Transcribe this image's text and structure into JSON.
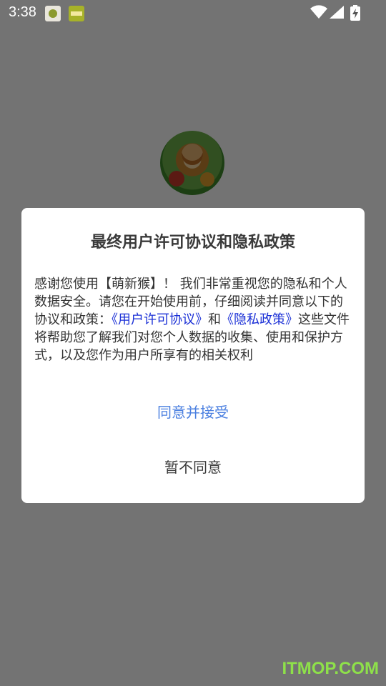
{
  "status_bar": {
    "time": "3:38",
    "notification_icons": [
      "app-notification-icon",
      "app-notification-icon"
    ],
    "system_icons": [
      "wifi-icon",
      "signal-icon",
      "battery-charging-icon"
    ]
  },
  "background": {
    "avatar": "app-logo-monkey"
  },
  "dialog": {
    "title": "最终用户许可协议和隐私政策",
    "body_part1": "感谢您使用【萌新猴】！ 我们非常重视您的隐私和个人数据安全。请您在开始使用前，仔细阅读并同意以下的协议和政策：",
    "link_user_agreement": "《用户许可协议》",
    "body_and": "和",
    "link_privacy_policy": "《隐私政策》",
    "body_part2": "这些文件将帮助您了解我们对您个人数据的收集、使用和保护方式，以及您作为用户所享有的相关权利",
    "agree_label": "同意并接受",
    "disagree_label": "暂不同意"
  },
  "watermark": "ITMOP.COM",
  "colors": {
    "scrim": "#000000",
    "link": "#1a2fd6",
    "agree": "#4a7fe0",
    "text": "#333333"
  }
}
